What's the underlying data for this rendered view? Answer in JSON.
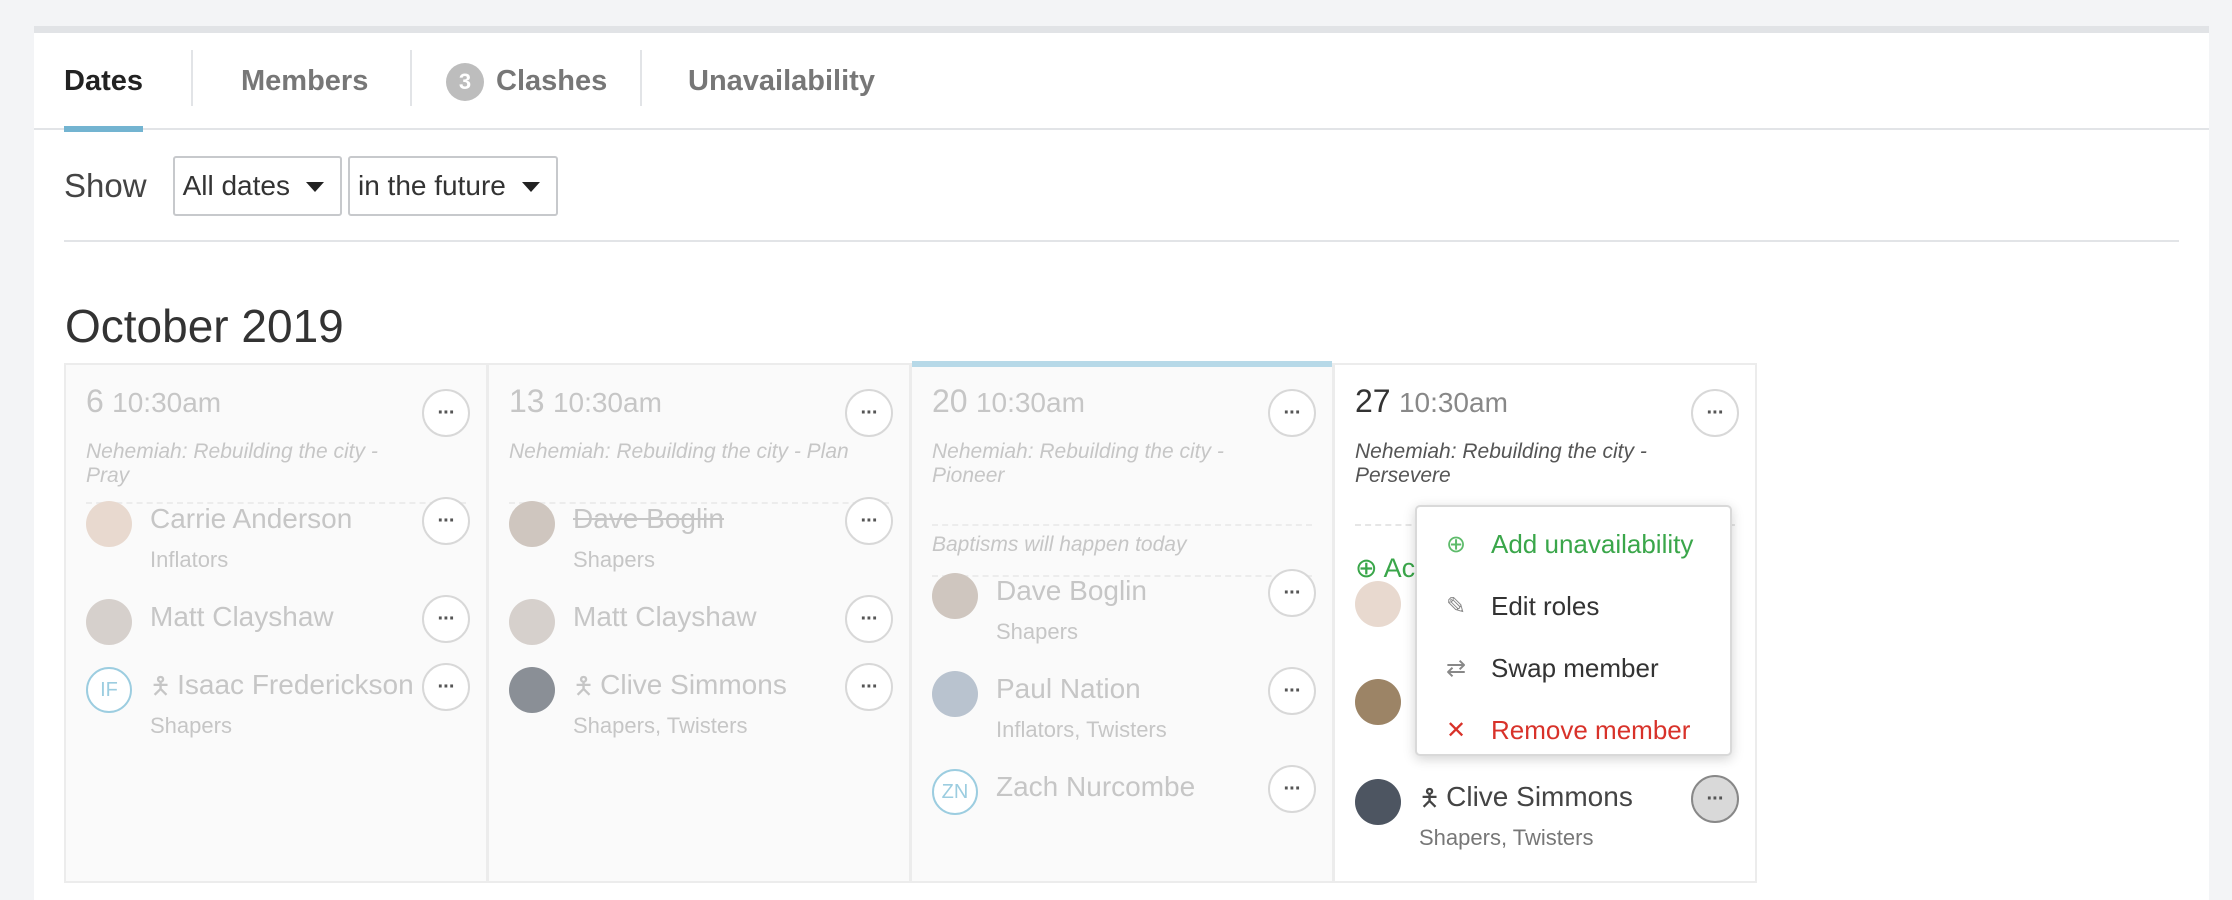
{
  "tabs": [
    {
      "label": "Dates"
    },
    {
      "label": "Members"
    },
    {
      "label": "Clashes",
      "badge": "3"
    },
    {
      "label": "Unavailability"
    }
  ],
  "filter": {
    "show_label": "Show",
    "range": "All dates",
    "when": "in the future"
  },
  "month": "October 2019",
  "columns": [
    {
      "date": "6",
      "time": "10:30am",
      "sermon": "Nehemiah: Rebuilding the city - Pray",
      "members": [
        {
          "name": "Carrie Anderson",
          "role": "Inflators"
        },
        {
          "name": "Matt Clayshaw",
          "role": ""
        },
        {
          "initials": "IF",
          "name": "Isaac Frederickson",
          "role": "Shapers"
        }
      ]
    },
    {
      "date": "13",
      "time": "10:30am",
      "sermon": "Nehemiah: Rebuilding the city - Plan",
      "members": [
        {
          "name": "Dave Boglin",
          "role": "Shapers"
        },
        {
          "name": "Matt Clayshaw",
          "role": ""
        },
        {
          "name": "Clive Simmons",
          "role": "Shapers, Twisters"
        }
      ]
    },
    {
      "date": "20",
      "time": "10:30am",
      "sermon": "Nehemiah: Rebuilding the city - Pioneer",
      "note": "Baptisms will happen today",
      "members": [
        {
          "name": "Dave Boglin",
          "role": "Shapers"
        },
        {
          "name": "Paul Nation",
          "role": "Inflators, Twisters"
        },
        {
          "initials": "ZN",
          "name": "Zach Nurcombe",
          "role": ""
        }
      ]
    },
    {
      "date": "27",
      "time": "10:30am",
      "sermon": "Nehemiah: Rebuilding the city - Persevere",
      "add_label": "Ac",
      "members": [
        {
          "name": "Clive Simmons",
          "role": "Shapers, Twisters"
        }
      ]
    }
  ],
  "menu": {
    "add_unavailability": "Add unavailability",
    "edit_roles": "Edit roles",
    "swap_member": "Swap member",
    "remove_member": "Remove member"
  },
  "icons": {
    "more": "ellipsis-icon",
    "leader": "person-icon",
    "add": "plus-circle-icon",
    "edit": "pencil-icon",
    "swap": "swap-icon",
    "remove": "close-icon"
  },
  "colors": {
    "accent": "#73b4d1",
    "green": "#3aa64a",
    "red": "#d8322a"
  }
}
